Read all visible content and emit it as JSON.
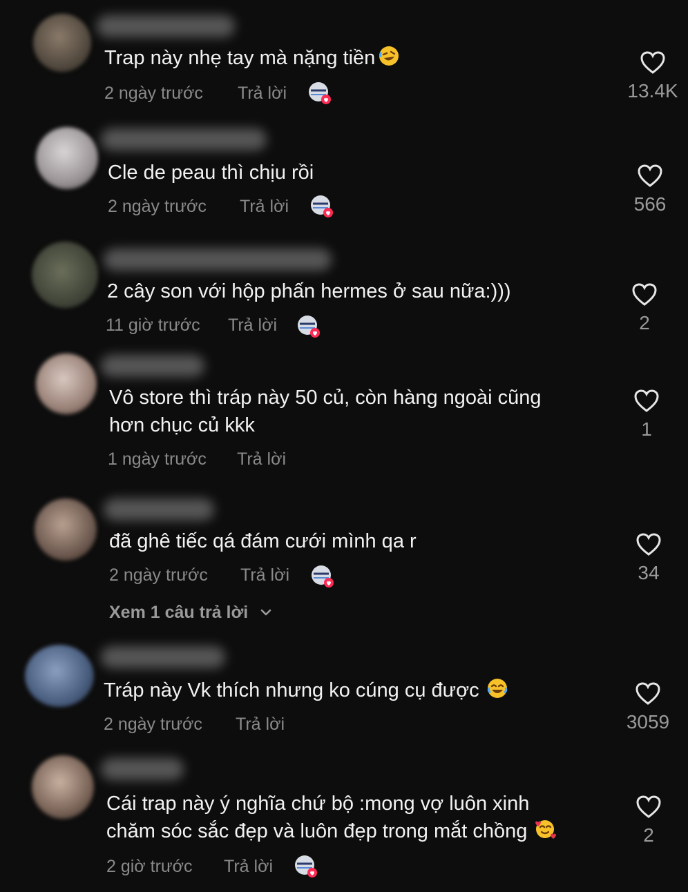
{
  "reply_label": "Trả lời",
  "comments": [
    {
      "text": "Trap này nhẹ tay mà nặng tiền",
      "emoji": "rofl",
      "time": "2 ngày trước",
      "likes": "13.4K",
      "creator_liked": true
    },
    {
      "text": "Cle de peau thì chịu rồi",
      "time": "2 ngày trước",
      "likes": "566",
      "creator_liked": true
    },
    {
      "text": "2 cây son với hộp phấn hermes ở sau nữa:)))",
      "time": "11 giờ trước",
      "likes": "2",
      "creator_liked": true
    },
    {
      "text_line1": "Vô store thì tráp này 50 củ, còn hàng ngoài cũng",
      "text_line2": "hơn chục củ kkk",
      "time": "1 ngày trước",
      "likes": "1",
      "creator_liked": false
    },
    {
      "text": "đã ghê tiếc qá đám cưới mình qa r",
      "time": "2 ngày trước",
      "likes": "34",
      "creator_liked": true,
      "view_replies": "Xem 1 câu trả lời"
    },
    {
      "text": "Tráp này Vk thích nhưng ko cúng cụ được",
      "emoji": "joy",
      "time": "2 ngày trước",
      "likes": "3059",
      "creator_liked": false
    },
    {
      "text_line1": "Cái trap này ý nghĩa chứ bộ :mong vợ luôn xinh",
      "text_line2": "chăm sóc sắc đẹp và luôn đẹp trong mắt chồng",
      "emoji": "smiling-hearts",
      "time": "2 giờ trước",
      "likes": "2",
      "creator_liked": true
    }
  ],
  "colors": {
    "background": "#0d0d0d",
    "text": "#f2f2f2",
    "meta": "#8a8a8a",
    "heart_badge": "#fe2c55"
  }
}
